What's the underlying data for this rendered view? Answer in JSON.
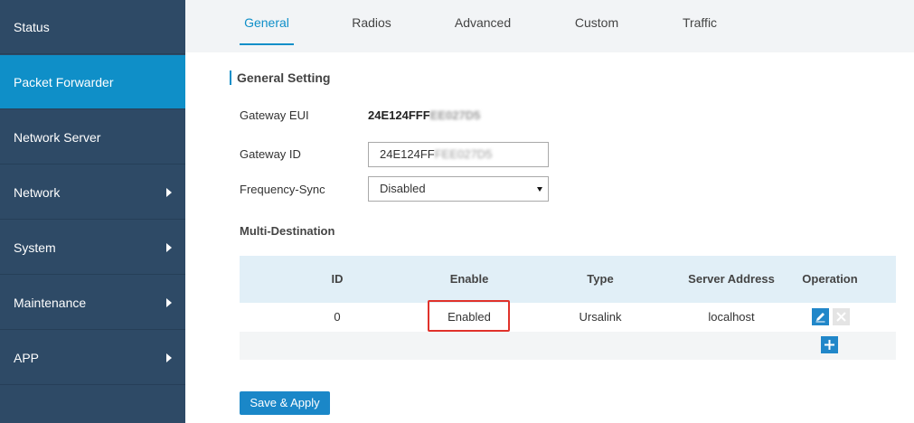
{
  "sidebar": {
    "items": [
      {
        "label": "Status",
        "has_submenu": false
      },
      {
        "label": "Packet Forwarder",
        "has_submenu": false,
        "active": true
      },
      {
        "label": "Network Server",
        "has_submenu": false
      },
      {
        "label": "Network",
        "has_submenu": true
      },
      {
        "label": "System",
        "has_submenu": true
      },
      {
        "label": "Maintenance",
        "has_submenu": true
      },
      {
        "label": "APP",
        "has_submenu": true
      }
    ]
  },
  "tabs": [
    {
      "label": "General",
      "active": true
    },
    {
      "label": "Radios"
    },
    {
      "label": "Advanced"
    },
    {
      "label": "Custom"
    },
    {
      "label": "Traffic"
    }
  ],
  "general": {
    "section_title": "General Setting",
    "gateway_eui_label": "Gateway EUI",
    "gateway_eui_value_visible": "24E124FFF",
    "gateway_eui_value_blurred": "EE027D5",
    "gateway_id_label": "Gateway ID",
    "gateway_id_value_visible": "24E124FF",
    "gateway_id_value_blurred": "FEE027D5",
    "frequency_sync_label": "Frequency-Sync",
    "frequency_sync_value": "Disabled"
  },
  "multi_destination": {
    "heading": "Multi-Destination",
    "columns": [
      "ID",
      "Enable",
      "Type",
      "Server Address",
      "Operation"
    ],
    "rows": [
      {
        "id": "0",
        "enable": "Enabled",
        "type": "Ursalink",
        "server_address": "localhost"
      }
    ]
  },
  "actions": {
    "save_label": "Save & Apply"
  },
  "colors": {
    "sidebar_bg": "#2e4a66",
    "sidebar_active": "#0f8fc8",
    "accent": "#0f8fc8",
    "highlight_border": "#e0322b"
  }
}
